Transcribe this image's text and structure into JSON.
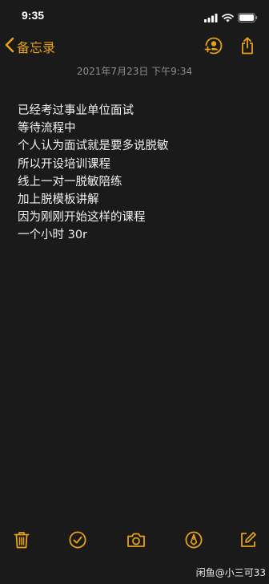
{
  "status": {
    "time": "9:35"
  },
  "nav": {
    "back_label": "备忘录"
  },
  "note": {
    "timestamp": "2021年7月23日 下午9:34",
    "lines": [
      "已经考过事业单位面试",
      "等待流程中",
      "个人认为面试就是要多说脱敏",
      "所以开设培训课程",
      "线上一对一脱敏陪练",
      "加上脱模板讲解",
      "因为刚刚开始这样的课程",
      "一个小时 30r"
    ]
  },
  "watermark": "闲鱼@小三可33",
  "colors": {
    "accent": "#e6a117",
    "background": "#1a1a1a",
    "text": "#f2f2f2",
    "timestamp": "#8e8e93"
  },
  "icons": {
    "signal": "signal-bars-icon",
    "wifi": "wifi-icon",
    "battery": "battery-icon",
    "back": "chevron-left-icon",
    "collaborate": "add-person-icon",
    "share": "share-icon",
    "delete": "trash-icon",
    "checklist": "checkmark-circle-icon",
    "camera": "camera-icon",
    "markup": "pen-circle-icon",
    "compose": "compose-icon"
  }
}
